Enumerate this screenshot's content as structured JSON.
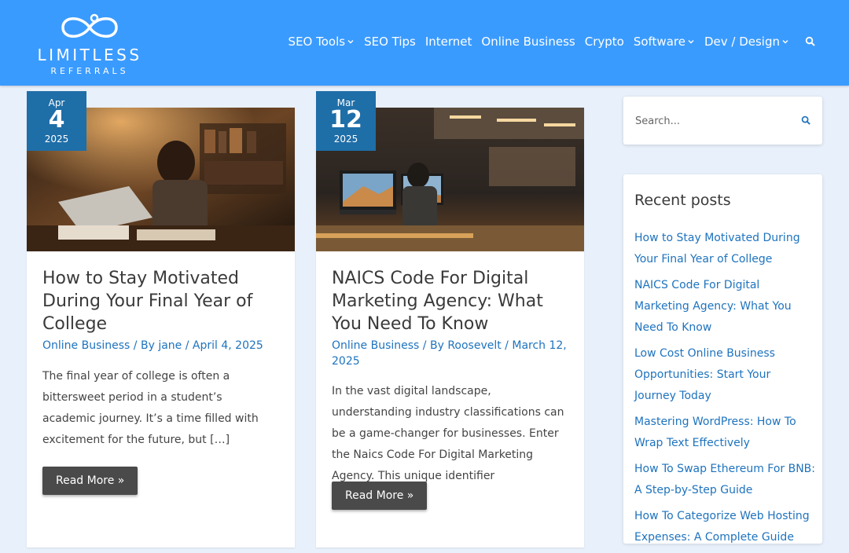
{
  "brand": {
    "name": "LIMITLESS",
    "sub": "REFERRALS"
  },
  "nav": {
    "items": [
      {
        "label": "SEO Tools",
        "dropdown": true
      },
      {
        "label": "SEO Tips",
        "dropdown": false
      },
      {
        "label": "Internet",
        "dropdown": false
      },
      {
        "label": "Online Business",
        "dropdown": false
      },
      {
        "label": "Crypto",
        "dropdown": false
      },
      {
        "label": "Software",
        "dropdown": true
      },
      {
        "label": "Dev / Design",
        "dropdown": true
      }
    ]
  },
  "posts": [
    {
      "month": "Apr",
      "day": "4",
      "year": "2025",
      "title": "How to Stay Motivated During Your Final Year of College",
      "category": "Online Business",
      "by": " / By ",
      "author": "jane",
      "sep": " / ",
      "date": "April 4, 2025",
      "excerpt": "The final year of college is often a bittersweet period in a student’s academic journey. It’s a time filled with excitement for the future, but […]",
      "read_more": "Read More »"
    },
    {
      "month": "Mar",
      "day": "12",
      "year": "2025",
      "title": "NAICS Code For Digital Marketing Agency: What You Need To Know",
      "category": "Online Business",
      "by": " / By ",
      "author": "Roosevelt",
      "sep": " / ",
      "date": "March 12, 2025",
      "excerpt": "In the vast digital landscape, understanding industry classifications can be a game-changer for businesses. Enter the Naics Code For Digital Marketing Agency. This unique identifier",
      "read_more": "Read More »"
    }
  ],
  "sidebar": {
    "search_placeholder": "Search...",
    "recent_title": "Recent posts",
    "recent": [
      "How to Stay Motivated During Your Final Year of College",
      "NAICS Code For Digital Marketing Agency: What You Need To Know",
      "Low Cost Online Business Opportunities: Start Your Journey Today",
      "Mastering WordPress: How To Wrap Text Effectively",
      "How To Swap Ethereum For BNB: A Step-by-Step Guide",
      "How To Categorize Web Hosting Expenses: A Complete Guide"
    ]
  },
  "colors": {
    "header": "#3a9bff",
    "badge": "#1e6ea8",
    "link": "#1e73be",
    "button": "#4a4a4a"
  }
}
